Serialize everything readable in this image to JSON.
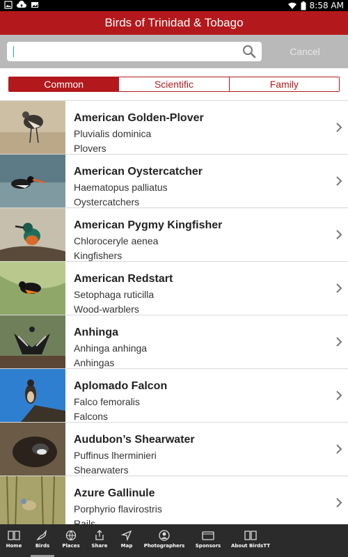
{
  "status_bar": {
    "time": "8:58 AM"
  },
  "title": "Birds of Trinidad & Tobago",
  "search": {
    "value": "",
    "placeholder": "",
    "cancel_label": "Cancel"
  },
  "segments": [
    {
      "label": "Common",
      "active": true
    },
    {
      "label": "Scientific",
      "active": false
    },
    {
      "label": "Family",
      "active": false
    }
  ],
  "birds": [
    {
      "name": "American Golden-Plover",
      "scientific": "Pluvialis dominica",
      "family": "Plovers"
    },
    {
      "name": "American Oystercatcher",
      "scientific": "Haematopus palliatus",
      "family": "Oystercatchers"
    },
    {
      "name": "American Pygmy Kingfisher",
      "scientific": "Chloroceryle aenea",
      "family": "Kingfishers"
    },
    {
      "name": "American Redstart",
      "scientific": "Setophaga ruticilla",
      "family": "Wood-warblers"
    },
    {
      "name": "Anhinga",
      "scientific": "Anhinga anhinga",
      "family": "Anhingas"
    },
    {
      "name": "Aplomado Falcon",
      "scientific": "Falco femoralis",
      "family": "Falcons"
    },
    {
      "name": "Audubon’s Shearwater",
      "scientific": "Puffinus lherminieri",
      "family": "Shearwaters"
    },
    {
      "name": "Azure Gallinule",
      "scientific": "Porphyrio flavirostris",
      "family": "Rails"
    }
  ],
  "nav": [
    {
      "label": "Home",
      "icon": "book-icon"
    },
    {
      "label": "Birds",
      "icon": "bird-icon",
      "active": true
    },
    {
      "label": "Places",
      "icon": "globe-icon"
    },
    {
      "label": "Share",
      "icon": "share-icon"
    },
    {
      "label": "Map",
      "icon": "location-arrow-icon"
    },
    {
      "label": "Photographers",
      "icon": "person-icon"
    },
    {
      "label": "Sponsors",
      "icon": "folder-icon"
    },
    {
      "label": "About BirdsTT",
      "icon": "open-book-icon"
    }
  ],
  "colors": {
    "accent": "#b3191c",
    "nav_bg": "#2b2b2b",
    "search_bg": "#b9b9b9"
  }
}
